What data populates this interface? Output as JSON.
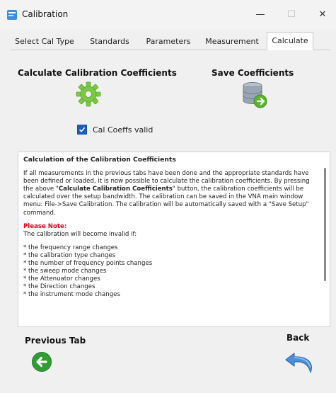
{
  "window": {
    "title": "Calibration",
    "minimize_glyph": "—",
    "maximize_glyph": "☐",
    "close_glyph": "✕"
  },
  "tabs": [
    {
      "label": "Select Cal Type",
      "active": false
    },
    {
      "label": "Standards",
      "active": false
    },
    {
      "label": "Parameters",
      "active": false
    },
    {
      "label": "Measurement",
      "active": false
    },
    {
      "label": "Calculate",
      "active": true
    }
  ],
  "calculate": {
    "title": "Calculate Calibration Coefficients",
    "icon": "gear-icon"
  },
  "save": {
    "title": "Save Coefficients",
    "icon": "database-save-icon"
  },
  "cal_valid": {
    "label": "Cal Coeffs valid",
    "checked": true
  },
  "info": {
    "title": "Calculation of the Calibration Coefficients",
    "para_before": "If all measurements in the previous tabs have been done and the appropriate standards have been defined or loaded, it is now possible to calculate the calibration coefficients. By pressing the above \"",
    "para_bold": "Calculate Calibration Coefficients",
    "para_after": "\" button, the calibration coefficients  will be calculated over the setup bandwidth. The calibration can be saved in the VNA main window menu: File->Save Calibration. The calibration will be automatically saved with a \"Save Setup\" command.",
    "note_title": "Please Note:",
    "note_intro": "The calibration will become invalid if:",
    "items": [
      "* the frequency range changes",
      "* the calibration type changes",
      "* the number of frequency points changes",
      "* the sweep mode changes",
      "* the Attenuator changes",
      "* the Direction changes",
      "* the instrument mode changes"
    ]
  },
  "navigation": {
    "previous_label": "Previous Tab",
    "back_label": "Back"
  },
  "colors": {
    "accent": "#1a5fb4",
    "note_red": "#e0001b",
    "gear_green": "#7ac943",
    "arrow_green": "#2e9d32",
    "back_blue": "#4a8fd8"
  }
}
